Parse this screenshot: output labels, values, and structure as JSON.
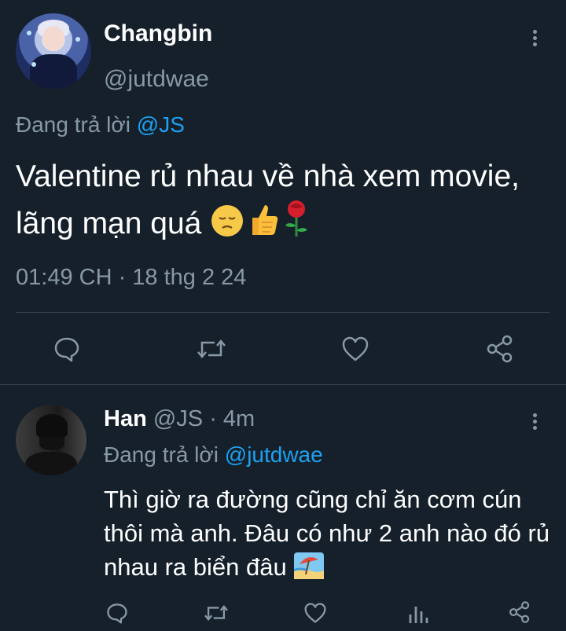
{
  "main_tweet": {
    "author_name": "Changbin",
    "author_handle": "@jutdwae",
    "replying_prefix": "Đang trả lời ",
    "replying_to": "@JS",
    "text": "Valentine rủ nhau về nhà xem movie, lãng mạn quá",
    "emojis": [
      "pensive-face",
      "thumbs-up",
      "rose"
    ],
    "timestamp": "01:49 CH · 18 thg 2 24",
    "actions": [
      "reply-icon",
      "retweet-icon",
      "like-icon",
      "share-icon"
    ]
  },
  "reply_tweet": {
    "author_name": "Han",
    "author_handle": "@JS",
    "time_ago": "· 4m",
    "replying_prefix": "Đang trả lời ",
    "replying_to": "@jutdwae",
    "text": "Thì giờ ra đường cũng chỉ ăn cơm cún thôi mà anh. Đâu có như 2 anh nào đó rủ nhau ra biển đâu",
    "emojis": [
      "beach-with-umbrella"
    ],
    "actions": [
      "reply-icon",
      "retweet-icon",
      "like-icon",
      "analytics-icon",
      "share-icon"
    ]
  },
  "colors": {
    "background": "#15202b",
    "text_primary": "#ffffff",
    "text_secondary": "#8899a6",
    "accent": "#1da1f2",
    "divider": "#38444d"
  }
}
